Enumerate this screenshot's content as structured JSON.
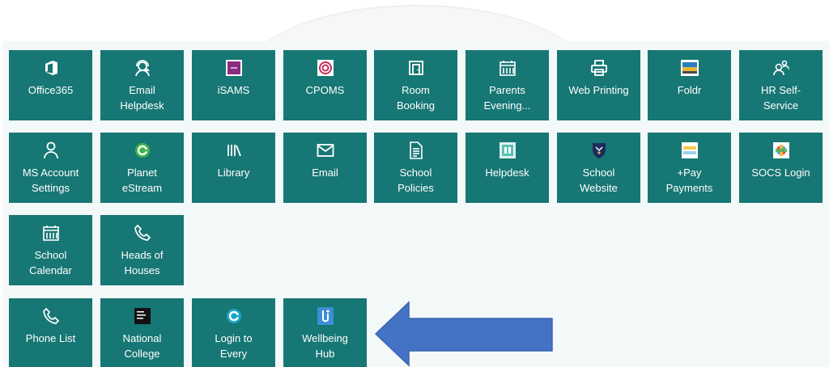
{
  "tiles": [
    {
      "label": "Office365",
      "icon": "office365-icon"
    },
    {
      "label": "Email\nHelpdesk",
      "icon": "helpdesk-headset-icon"
    },
    {
      "label": "iSAMS",
      "icon": "isams-logo-icon"
    },
    {
      "label": "CPOMS",
      "icon": "cpoms-target-icon"
    },
    {
      "label": "Room\nBooking",
      "icon": "room-booking-icon"
    },
    {
      "label": "Parents\nEvening...",
      "icon": "calendar-icon"
    },
    {
      "label": "Web Printing",
      "icon": "printer-icon"
    },
    {
      "label": "Foldr",
      "icon": "foldr-logo-icon"
    },
    {
      "label": "HR Self-\nService",
      "icon": "people-icon"
    },
    {
      "label": "MS Account\nSettings",
      "icon": "person-icon"
    },
    {
      "label": "Planet\neStream",
      "icon": "planet-estream-icon"
    },
    {
      "label": "Library",
      "icon": "library-books-icon"
    },
    {
      "label": "Email",
      "icon": "envelope-icon"
    },
    {
      "label": "School\nPolicies",
      "icon": "document-icon"
    },
    {
      "label": "Helpdesk",
      "icon": "helpdesk-logo-icon"
    },
    {
      "label": "School\nWebsite",
      "icon": "school-crest-icon"
    },
    {
      "label": "+Pay\nPayments",
      "icon": "pay-logo-icon"
    },
    {
      "label": "SOCS Login",
      "icon": "socs-logo-icon"
    },
    {
      "label": "School\nCalendar",
      "icon": "calendar-icon"
    },
    {
      "label": "Heads of\nHouses",
      "icon": "phone-icon"
    },
    {
      "label": "Phone List",
      "icon": "phone-icon"
    },
    {
      "label": "National\nCollege",
      "icon": "national-college-logo-icon"
    },
    {
      "label": "Login to\nEvery",
      "icon": "every-logo-icon"
    },
    {
      "label": "Wellbeing\nHub",
      "icon": "wellbeing-hub-logo-icon"
    }
  ],
  "colors": {
    "tile": "#177774",
    "panel": "#f3f8f8",
    "arrow": "#4472c4"
  }
}
